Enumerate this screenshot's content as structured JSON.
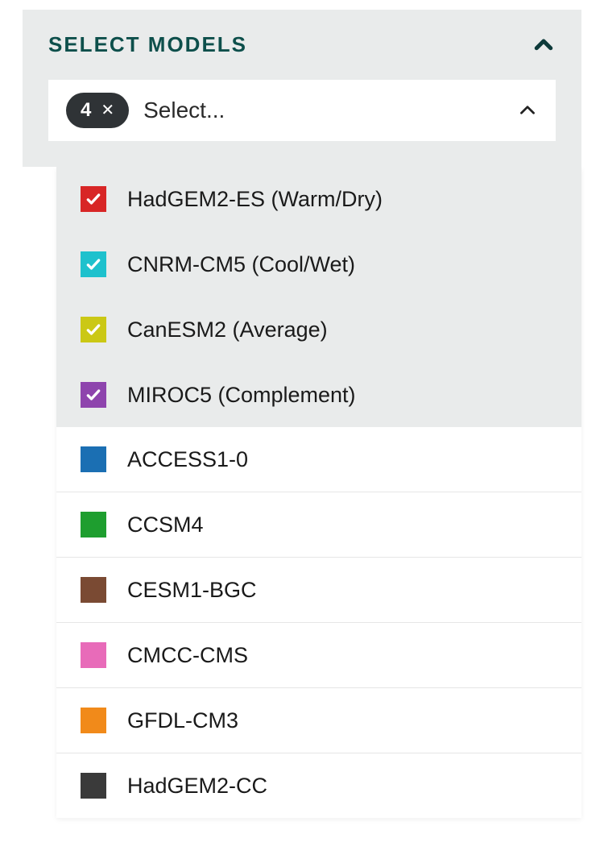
{
  "panel": {
    "title": "SELECT MODELS"
  },
  "select": {
    "count": "4",
    "placeholder": "Select..."
  },
  "options": [
    {
      "label": "HadGEM2-ES (Warm/Dry)",
      "color": "#d82626",
      "checked": true
    },
    {
      "label": "CNRM-CM5 (Cool/Wet)",
      "color": "#1ec1cd",
      "checked": true
    },
    {
      "label": "CanESM2 (Average)",
      "color": "#cbc815",
      "checked": true
    },
    {
      "label": "MIROC5 (Complement)",
      "color": "#8e44ad",
      "checked": true
    },
    {
      "label": "ACCESS1-0",
      "color": "#1b6fb3",
      "checked": false
    },
    {
      "label": "CCSM4",
      "color": "#1e9e2f",
      "checked": false
    },
    {
      "label": "CESM1-BGC",
      "color": "#7a4a33",
      "checked": false
    },
    {
      "label": "CMCC-CMS",
      "color": "#e86bb9",
      "checked": false
    },
    {
      "label": "GFDL-CM3",
      "color": "#f18a1a",
      "checked": false
    },
    {
      "label": "HadGEM2-CC",
      "color": "#3a3a3a",
      "checked": false
    }
  ]
}
